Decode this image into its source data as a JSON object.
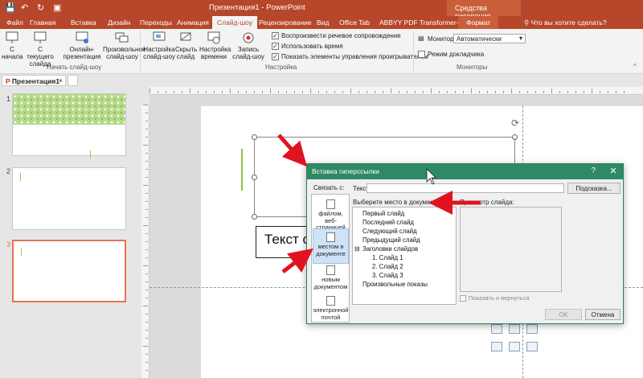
{
  "title_bar": {
    "title": "Презентация1 - PowerPoint",
    "context_group": "Средства рисования"
  },
  "tabs": {
    "file": "Файл",
    "home": "Главная",
    "insert": "Вставка",
    "design": "Дизайн",
    "transitions": "Переходы",
    "animations": "Анимация",
    "slideshow": "Слайд-шоу",
    "review": "Рецензирование",
    "view": "Вид",
    "officetab": "Office Tab",
    "abbyy": "ABBYY PDF Transformer+",
    "format": "Формат",
    "tell_me": "Что вы хотите сделать?"
  },
  "ribbon": {
    "from_beginning": "С начала",
    "from_current": "С текущего слайда",
    "online_presentation": "Онлайн-презентация",
    "custom_show": "Произвольное слайд-шоу",
    "group_start": "Начать слайд-шоу",
    "setup_show": "Настройка слайд-шоу",
    "hide_slide": "Скрыть слайд",
    "rehearse_timings": "Настройка времени",
    "record_show": "Запись слайд-шоу",
    "check_narration": "Воспроизвести речевое сопровождение",
    "check_timings": "Использовать время",
    "check_media_controls": "Показать элементы управления проигрывателем",
    "group_setup": "Настройка",
    "monitor_label": "Монитор:",
    "monitor_value": "Автоматически",
    "presenter_view": "Режим докладчика",
    "group_monitors": "Мониторы"
  },
  "document_tab": {
    "name": "Презентация1"
  },
  "thumbnails": [
    {
      "number": "1"
    },
    {
      "number": "2"
    },
    {
      "number": "3"
    }
  ],
  "slide": {
    "text": "Текст сл"
  },
  "dialog": {
    "title": "Вставка гиперссылки",
    "help": "?",
    "close": "✕",
    "link_with_label": "Связать с:",
    "link_options": [
      "файлом, веб-страницей",
      "местом в документе",
      "новым документом",
      "электронной почтой"
    ],
    "text_label": "Текст:",
    "text_value": "",
    "hint_button": "Подсказка...",
    "choose_place_label": "Выберите место в документе:",
    "tree": [
      "Первый слайд",
      "Последний слайд",
      "Следующий слайд",
      "Предыдущий слайд",
      "Заголовки слайдов",
      "1. Слайд 1",
      "2. Слайд 2",
      "3. Слайд 3",
      "Произвольные показы"
    ],
    "preview_label": "Просмотр слайда:",
    "show_and_return": "Показать и вернуться",
    "ok_button": "ОК",
    "cancel_button": "Отмена"
  },
  "colors": {
    "powerpoint_accent": "#b7472a",
    "dialog_titlebar": "#2f8a63",
    "annotation_arrow": "#e0141e",
    "selected_slide_border": "#e8734f"
  }
}
